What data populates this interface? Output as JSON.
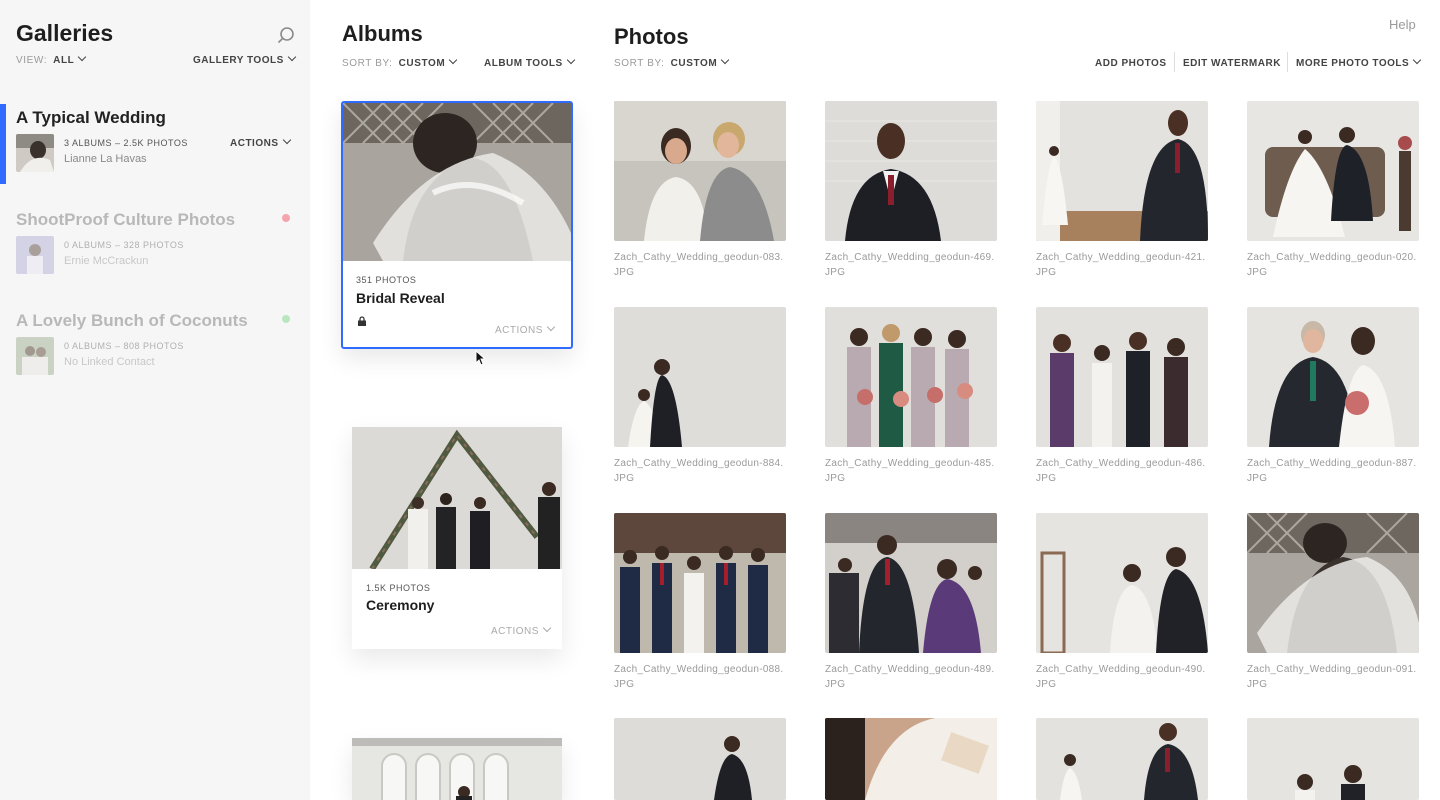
{
  "sidebar": {
    "title": "Galleries",
    "view_label": "VIEW:",
    "view_value": "ALL",
    "tools_label": "GALLERY TOOLS",
    "galleries": [
      {
        "name": "A Typical Wedding",
        "meta": "3 ALBUMS – 2.5K PHOTOS",
        "contact": "Lianne La Havas",
        "actions": "ACTIONS",
        "active": true
      },
      {
        "name": "ShootProof Culture Photos",
        "meta": "0 ALBUMS – 328 PHOTOS",
        "contact": "Ernie McCrackun",
        "dot_color": "#f3a4ad"
      },
      {
        "name": "A Lovely Bunch of Coconuts",
        "meta": "0 ALBUMS – 808 PHOTOS",
        "contact": "No Linked Contact",
        "dot_color": "#b9e6be"
      }
    ]
  },
  "albums": {
    "title": "Albums",
    "sort_label": "SORT BY:",
    "sort_value": "CUSTOM",
    "tools_label": "ALBUM TOOLS",
    "items": [
      {
        "count": "351 PHOTOS",
        "name": "Bridal Reveal",
        "actions": "ACTIONS",
        "locked": true,
        "selected": true
      },
      {
        "count": "1.5K PHOTOS",
        "name": "Ceremony",
        "actions": "ACTIONS"
      },
      {
        "count": "",
        "name": "",
        "actions": ""
      }
    ]
  },
  "photos": {
    "title": "Photos",
    "sort_label": "SORT BY:",
    "sort_value": "CUSTOM",
    "help": "Help",
    "tools": [
      "ADD PHOTOS",
      "EDIT WATERMARK",
      "MORE PHOTO TOOLS"
    ],
    "items": [
      "Zach_Cathy_Wedding_geodun-083.JPG",
      "Zach_Cathy_Wedding_geodun-469.JPG",
      "Zach_Cathy_Wedding_geodun-421.JPG",
      "Zach_Cathy_Wedding_geodun-020.JPG",
      "Zach_Cathy_Wedding_geodun-884.JPG",
      "Zach_Cathy_Wedding_geodun-485.JPG",
      "Zach_Cathy_Wedding_geodun-486.JPG",
      "Zach_Cathy_Wedding_geodun-887.JPG",
      "Zach_Cathy_Wedding_geodun-088.JPG",
      "Zach_Cathy_Wedding_geodun-489.JPG",
      "Zach_Cathy_Wedding_geodun-490.JPG",
      "Zach_Cathy_Wedding_geodun-091.JPG",
      "",
      "",
      "",
      ""
    ]
  },
  "colors": {
    "accent": "#2f6bff"
  }
}
